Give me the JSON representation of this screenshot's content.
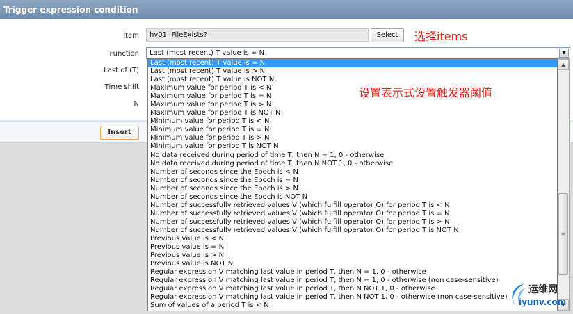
{
  "dialog": {
    "title": "Trigger expression condition"
  },
  "labels": {
    "item": "Item",
    "function": "Function",
    "last_of": "Last of (T)",
    "time_shift": "Time shift",
    "n": "N"
  },
  "item_field": {
    "value": "hv01: FileExists?"
  },
  "buttons": {
    "select": "Select",
    "insert": "Insert"
  },
  "function_select": {
    "selected": "Last (most recent) T value is = N"
  },
  "dropdown_options": [
    "Last (most recent) T value is = N",
    "Last (most recent) T value is > N",
    "Last (most recent) T value is NOT N",
    "Maximum value for period T is < N",
    "Maximum value for period T is = N",
    "Maximum value for period T is > N",
    "Maximum value for period T is NOT N",
    "Minimum value for period T is < N",
    "Minimum value for period T is = N",
    "Minimum value for period T is > N",
    "Minimum value for period T is NOT N",
    "No data received during period of time T, then N = 1, 0 - otherwise",
    "No data received during period of time T, then N NOT 1, 0 - otherwise",
    "Number of seconds since the Epoch is < N",
    "Number of seconds since the Epoch is = N",
    "Number of seconds since the Epoch is > N",
    "Number of seconds since the Epoch is NOT N",
    "Number of successfully retrieved values V (which fulfill operator O) for period T is < N",
    "Number of successfully retrieved values V (which fulfill operator O) for period T is = N",
    "Number of successfully retrieved values V (which fulfill operator O) for period T is > N",
    "Number of successfully retrieved values V (which fulfill operator O) for period T is NOT N",
    "Previous value is < N",
    "Previous value is = N",
    "Previous value is > N",
    "Previous value is NOT N",
    "Regular expression V matching last value in period T, then N = 1, 0 - otherwise",
    "Regular expression V matching last value in period T, then N = 1, 0 - otherwise (non case-sensitive)",
    "Regular expression V matching last value in period T, then N NOT 1, 0 - otherwise",
    "Regular expression V matching last value in period T, then N NOT 1, 0 - otherwise (non case-sensitive)",
    "Sum of values of a period T is < N"
  ],
  "annotations": {
    "select_items": "选择items",
    "set_threshold": "设置表示式设置触发器阈值"
  },
  "watermark": {
    "cn": "运维网",
    "en": "iyunv.com"
  },
  "icons": {
    "dropdown_arrow": "chevron-down-icon",
    "scroll_up": "scroll-up-icon",
    "scroll_down": "scroll-down-icon"
  },
  "colors": {
    "title_bar": "#7b96b8",
    "selected_option": "#3399ff",
    "annotation": "#e0241b",
    "insert_border": "#e6a94e"
  }
}
